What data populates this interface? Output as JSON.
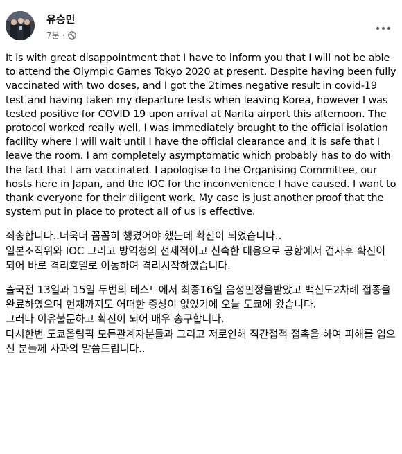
{
  "post": {
    "author": "유승민",
    "time": "7분",
    "separator": "·",
    "audience_icon": "globe-icon",
    "more_icon": "more-icon",
    "english_text": "It is with great disappointment that I have to inform you that I will not be able to attend the Olympic Games Tokyo 2020 at present. Despite having been fully vaccinated with two doses, and I got the 2times negative result in covid-19 test  and having taken my departure tests when leaving Korea, however I was tested positive for COVID 19 upon arrival at Narita airport this afternoon. The protocol worked really well, I was immediately brought to the official isolation facility where I will wait until I have the official clearance and it is safe that I leave the room. I am completely asymptomatic which probably has to do with the fact that I am vaccinated. I apologise to the Organising Committee, our hosts here in Japan, and the IOC for the inconvenience I have caused. I want to thank everyone for their diligent work. My case is just another proof that the system put in place to protect all of us is effective.",
    "korean_para1_line1": "죄송합니다..더욱더 꼼꼼히 챙겼어야 했는데 확진이 되었습니다..",
    "korean_para1_line2": "일본조직위와 IOC 그리고 방역청의 선제적이고 신속한 대응으로 공항에서 검사후 확진이 되어 바로 격리호텔로 이동하여 격리시작하였습니다.",
    "korean_para2_line1": "출국전 13일과 15일 두번의 테스트에서 최종16일 음성판정을받았고 백신도2차례 접종을 완료하였으며 현재까지도 어떠한 증상이 없었기에 오늘 도쿄에 왔습니다.",
    "korean_para2_line2": "그러나 이유불문하고 확진이 되어 매우 송구합니다.",
    "korean_para2_line3": "다시한번 도쿄올림픽 모든관계자분들과 그리고 저로인해 직간접적 접촉을 하여 피해를 입으신 분들께 사과의 말씀드립니다.."
  }
}
